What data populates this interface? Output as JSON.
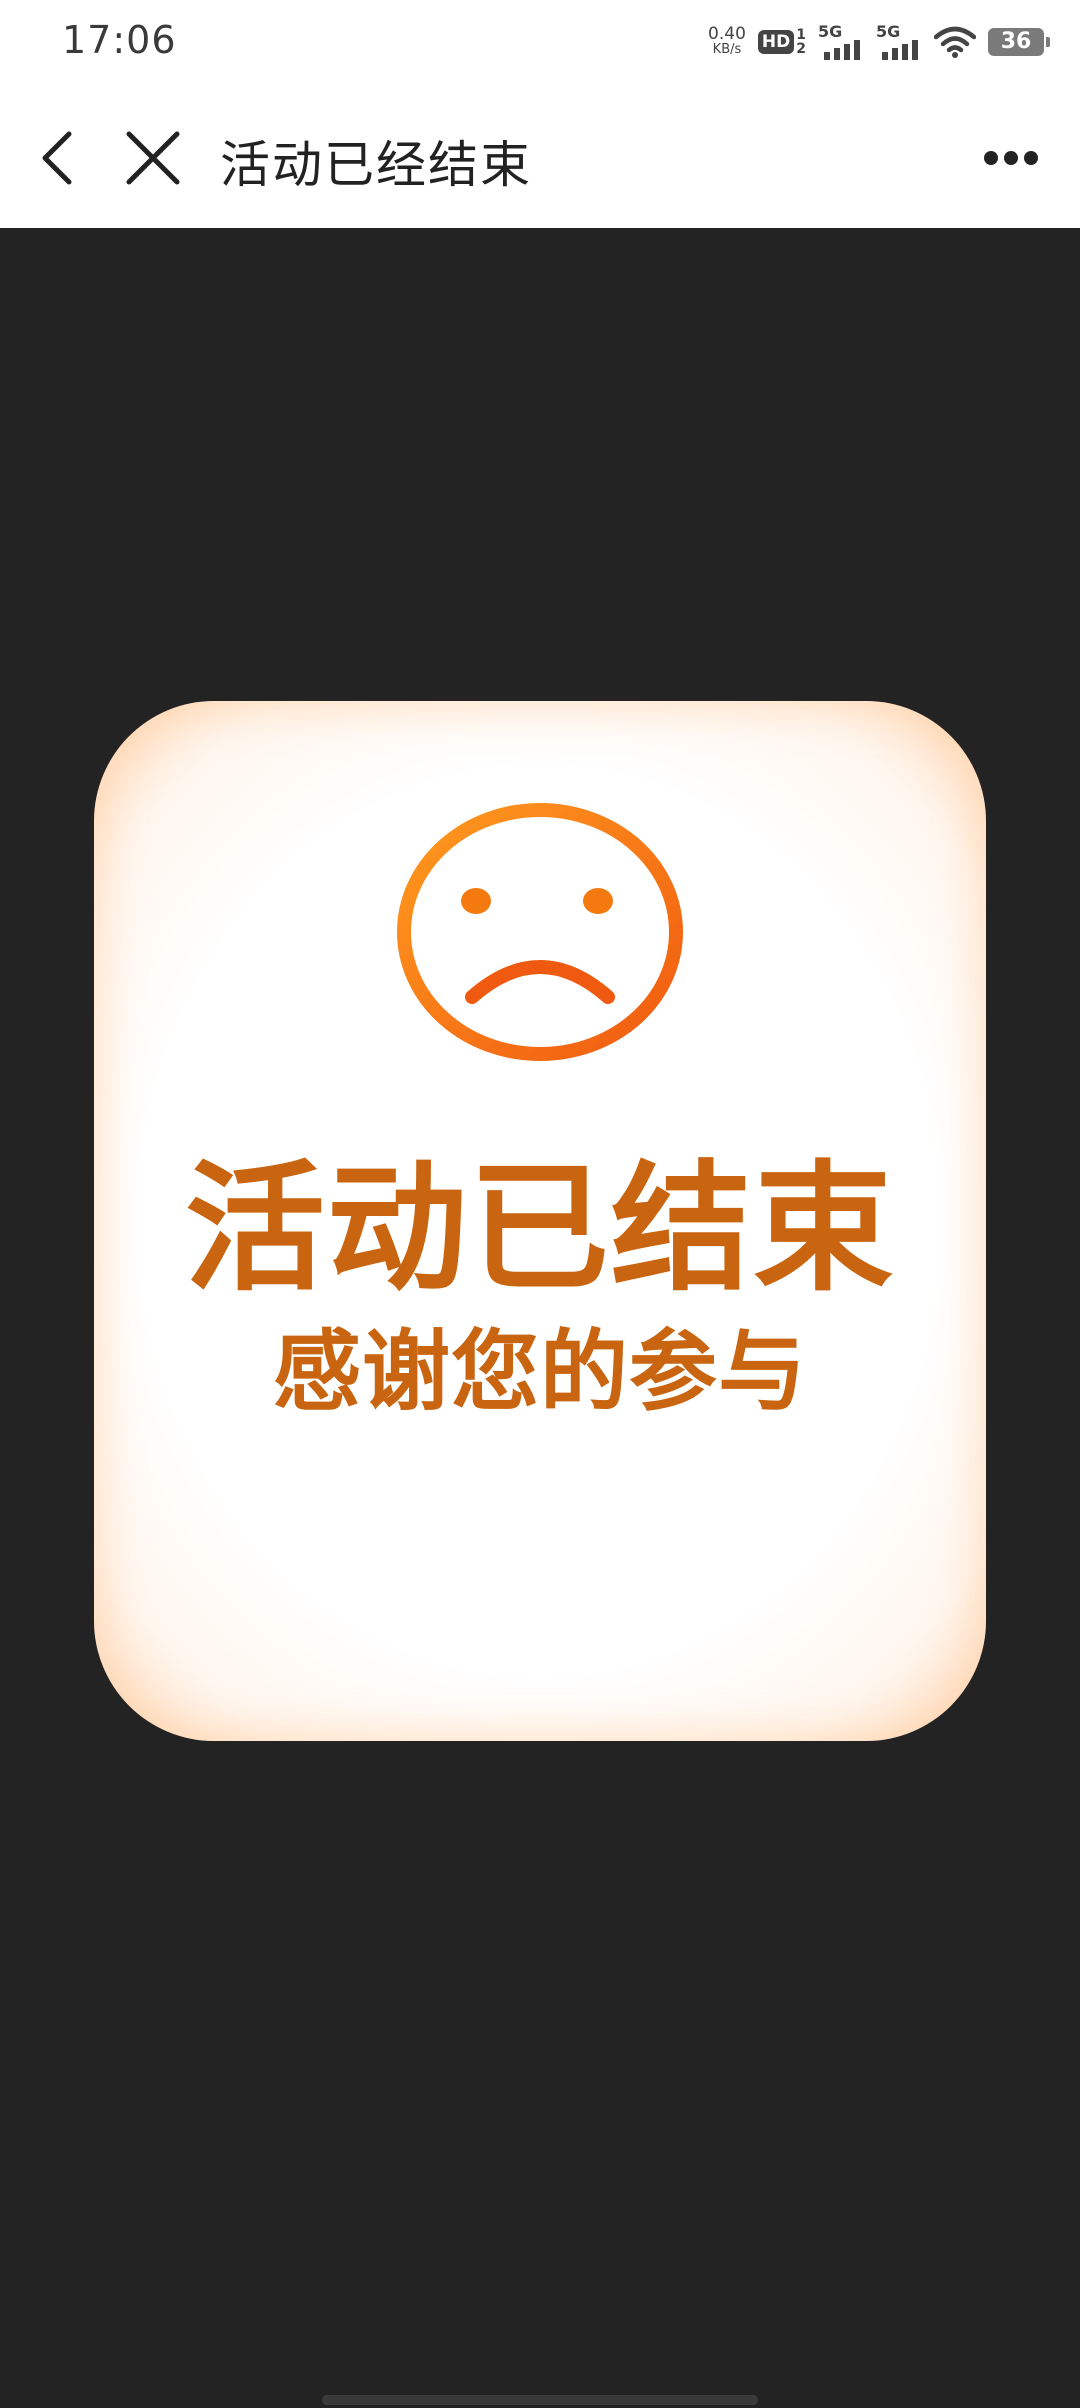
{
  "status_bar": {
    "time": "17:06",
    "net_speed_value": "0.40",
    "net_speed_unit": "KB/s",
    "hd_label": "HD",
    "hd_sub_top": "1",
    "hd_sub_bottom": "2",
    "signal1_label": "5G",
    "signal2_label": "5G",
    "battery_level": "36"
  },
  "nav": {
    "title": "活动已经结束",
    "icons": {
      "back": "back-arrow-icon",
      "close": "close-icon",
      "more": "more-options-icon"
    }
  },
  "card": {
    "title": "活动已结束",
    "subtitle": "感谢您的参与",
    "icon": "sad-face-icon"
  },
  "colors": {
    "background": "#232323",
    "accent": "#c96510",
    "face": "#f47a10"
  }
}
